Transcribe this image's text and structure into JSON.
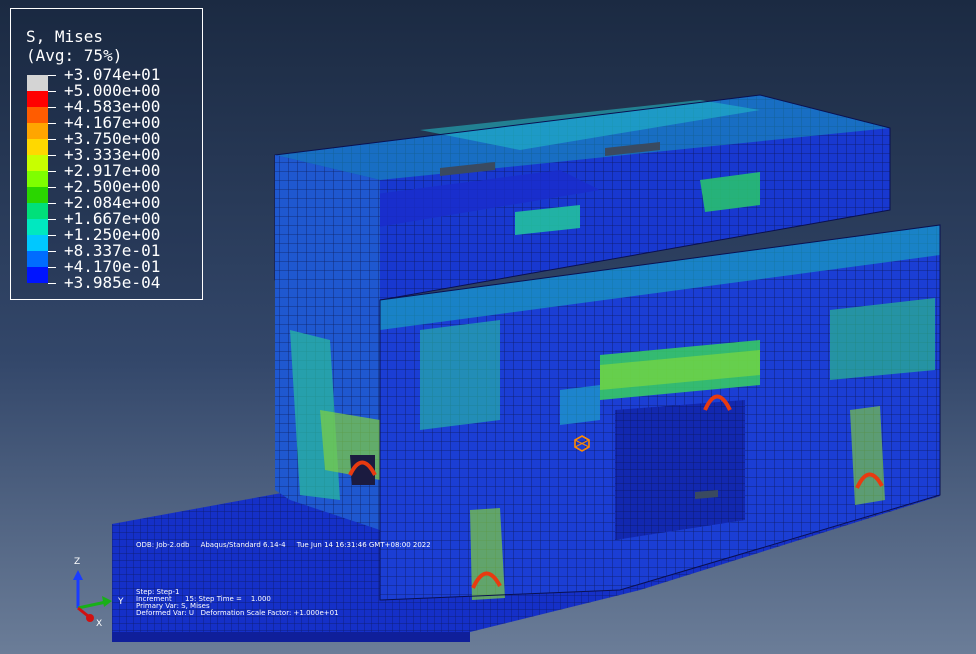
{
  "legend": {
    "title_line1": "S, Mises",
    "title_line2": "(Avg: 75%)",
    "entries": [
      {
        "value": "+3.074e+01",
        "color": "#d4d4d4"
      },
      {
        "value": "+5.000e+00",
        "color": "#ff0000"
      },
      {
        "value": "+4.583e+00",
        "color": "#ff5c00"
      },
      {
        "value": "+4.167e+00",
        "color": "#ffa500"
      },
      {
        "value": "+3.750e+00",
        "color": "#ffd800"
      },
      {
        "value": "+3.333e+00",
        "color": "#c8ff00"
      },
      {
        "value": "+2.917e+00",
        "color": "#7eff00"
      },
      {
        "value": "+2.500e+00",
        "color": "#2ad600"
      },
      {
        "value": "+2.084e+00",
        "color": "#00e07a"
      },
      {
        "value": "+1.667e+00",
        "color": "#00e8c0"
      },
      {
        "value": "+1.250e+00",
        "color": "#00c8ff"
      },
      {
        "value": "+8.337e-01",
        "color": "#006cff"
      },
      {
        "value": "+4.170e-01",
        "color": "#0014ff"
      },
      {
        "value": "+3.985e-04",
        "color": "#0000c8"
      }
    ]
  },
  "odb_line": "ODB: Job-2.odb     Abaqus/Standard 6.14-4     Tue Jun 14 16:31:46 GMT+08:00 2022",
  "step_info": {
    "line1": "Step: Step-1",
    "line2": "Increment      15: Step Time =    1.000",
    "line3": "Primary Var: S, Mises",
    "line4": "Deformed Var: U   Deformation Scale Factor: +1.000e+01"
  },
  "triad": {
    "z": "Z",
    "y": "Y",
    "x": "X"
  },
  "colors": {
    "mesh_blue": "#1a2fd8",
    "mesh_teal": "#1fb4c8",
    "hotspot": "#e83a10"
  }
}
